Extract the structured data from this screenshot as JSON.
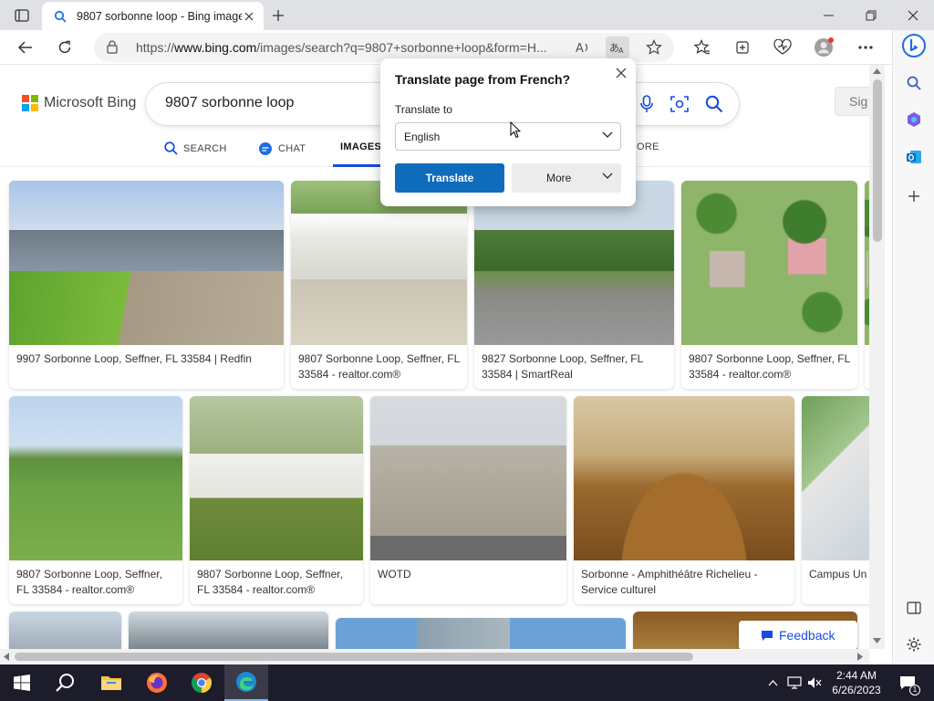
{
  "browser": {
    "tab_title": "9807 sorbonne loop - Bing images",
    "url_prefix": "https://",
    "url_host": "www.bing.com",
    "url_path": "/images/search?q=9807+sorbonne+loop&form=H..."
  },
  "page": {
    "logo_text": "Microsoft Bing",
    "search_query": "9807 sorbonne loop",
    "signin_label": "Sig",
    "scopes": [
      {
        "label": "SEARCH"
      },
      {
        "label": "CHAT"
      },
      {
        "label": "IMAGES"
      },
      {
        "label": "ORE"
      }
    ],
    "results": [
      {
        "caption": "9907 Sorbonne Loop, Seffner, FL 33584 | Redfin"
      },
      {
        "caption": "9807 Sorbonne Loop, Seffner, FL 33584 - realtor.com®"
      },
      {
        "caption": "9827 Sorbonne Loop, Seffner, FL 33584 | SmartReal"
      },
      {
        "caption": "9807 Sorbonne Loop, Seffner, FL 33584 - realtor.com®"
      },
      {
        "caption": "9807 Sorbonne Loop, Seffner, FL 33584 - realtor.com®"
      },
      {
        "caption": "9807 Sorbonne Loop, Seffner, FL 33584 - realtor.com®"
      },
      {
        "caption": "WOTD"
      },
      {
        "caption": "Sorbonne - Amphithéâtre Richelieu - Service culturel"
      },
      {
        "caption": "Campus Uni de Portzamp"
      }
    ],
    "feedback_label": "Feedback"
  },
  "translate_popup": {
    "title": "Translate page from French?",
    "translate_to_label": "Translate to",
    "selected_language": "English",
    "translate_button": "Translate",
    "more_button": "More"
  },
  "taskbar": {
    "time": "2:44 AM",
    "date": "6/26/2023",
    "notification_count": "1"
  },
  "colors": {
    "accent": "#174ae4",
    "translate_button": "#0f6cbd"
  }
}
